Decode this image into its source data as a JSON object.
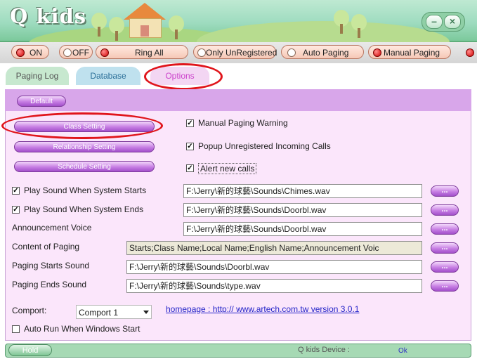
{
  "app": {
    "title": "Q kids"
  },
  "toolbar": {
    "on_label": "ON",
    "off_label": "OFF",
    "ring_all_label": "Ring All",
    "only_unregistered_label": "Only UnRegistered",
    "auto_paging_label": "Auto Paging",
    "manual_paging_label": "Manual Paging"
  },
  "tabs": [
    {
      "label": "Paging Log"
    },
    {
      "label": "Database"
    },
    {
      "label": "Options"
    }
  ],
  "options": {
    "default_label": "Default",
    "class_setting_label": "Class Setting",
    "relationship_setting_label": "Relationship Setting",
    "schedule_setting_label": "Schedule Setting",
    "manual_paging_warning": {
      "label": "Manual Paging Warning",
      "checked": true
    },
    "popup_unregistered": {
      "label": "Popup Unregistered Incoming Calls",
      "checked": true
    },
    "alert_new_calls": {
      "label": "Alert new calls",
      "checked": true
    },
    "play_sound_starts": {
      "label": "Play Sound When System Starts",
      "checked": true,
      "value": "F:\\Jerry\\新的球藝\\Sounds\\Chimes.wav"
    },
    "play_sound_ends": {
      "label": "Play Sound When System Ends",
      "checked": true,
      "value": "F:\\Jerry\\新的球藝\\Sounds\\Doorbl.wav"
    },
    "announcement_voice": {
      "label": "Announcement Voice",
      "value": "F:\\Jerry\\新的球藝\\Sounds\\Doorbl.wav"
    },
    "content_of_paging": {
      "label": "Content of Paging",
      "value": "Starts;Class Name;Local Name;English Name;Announcement Voic"
    },
    "paging_starts_sound": {
      "label": "Paging Starts Sound",
      "value": "F:\\Jerry\\新的球藝\\Sounds\\Doorbl.wav"
    },
    "paging_ends_sound": {
      "label": "Paging Ends Sound",
      "value": "F:\\Jerry\\新的球藝\\Sounds\\type.wav"
    },
    "browse_label": "...",
    "comport": {
      "label": "Comport:",
      "value": "Comport 1"
    },
    "homepage_link": "homepage : http:// www.artech.com.tw  version 3.0.1",
    "auto_run": {
      "label": "Auto Run When Windows Start",
      "checked": false
    }
  },
  "status": {
    "hold_label": "Hold",
    "device_label": "Q kids Device :",
    "device_value": "Ok"
  },
  "colors": {
    "annotation_circle": "#e0151b",
    "options_tab": "#cc44cc",
    "panel_bg": "#fbe6fb"
  }
}
